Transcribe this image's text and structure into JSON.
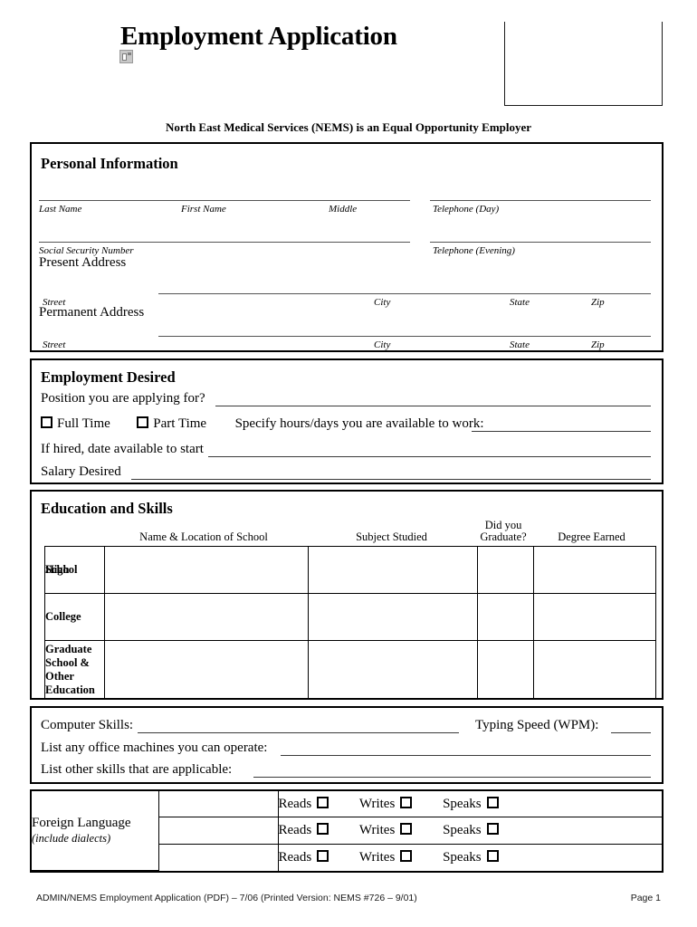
{
  "header": {
    "title": "Employment Application",
    "logo_icon": "broken-image-icon",
    "eeo_statement": "North East Medical Services (NEMS) is an Equal Opportunity Employer"
  },
  "personal_information": {
    "title": "Personal Information",
    "labels": {
      "last_name": "Last Name",
      "first_name": "First Name",
      "middle": "Middle",
      "telephone_day": "Telephone (Day)",
      "social_security_number": "Social Security Number",
      "telephone_evening": "Telephone (Evening)",
      "present_address": "Present Address",
      "permanent_address": "Permanent Address",
      "street": "Street",
      "city": "City",
      "state": "State",
      "zip": "Zip",
      "street2": "Street",
      "city2": "City",
      "state2": "State",
      "zip2": "Zip"
    }
  },
  "employment_desired": {
    "title": "Employment Desired",
    "position_label": "Position you are applying for?",
    "full_time_label": "Full Time",
    "part_time_label": "Part Time",
    "specify_hours_label": "Specify hours/days you are available to work:",
    "date_available_label": "If hired, date available to start",
    "salary_label": "Salary Desired"
  },
  "education": {
    "title": "Education and Skills",
    "columns": [
      "Name & Location of School",
      "Subject Studied",
      "Did you\nGraduate?",
      "Degree Earned"
    ],
    "column_graduate_line1": "Did you",
    "column_graduate_line2": "Graduate?",
    "rows": [
      {
        "label": "High School",
        "overlap_a": "High",
        "overlap_b": "School"
      },
      {
        "label": "College"
      },
      {
        "label": "Graduate School & Other Education"
      }
    ],
    "row3_lines": [
      "Graduate",
      "School &",
      "Other",
      "Education"
    ]
  },
  "skills": {
    "computer_skills_label": "Computer Skills:",
    "typing_speed_label": "Typing Speed (WPM):",
    "office_machines_label": "List any office machines you can operate:",
    "other_skills_label": "List other skills that are applicable:"
  },
  "foreign_language": {
    "name": "Foreign Language",
    "note": "(include dialects)",
    "skills": [
      "Reads",
      "Writes",
      "Speaks"
    ],
    "row_count": 3
  },
  "footer": {
    "left": "ADMIN/NEMS Employment Application (PDF) – 7/06 (Printed Version: NEMS #726 – 9/01)",
    "right": "Page 1"
  }
}
